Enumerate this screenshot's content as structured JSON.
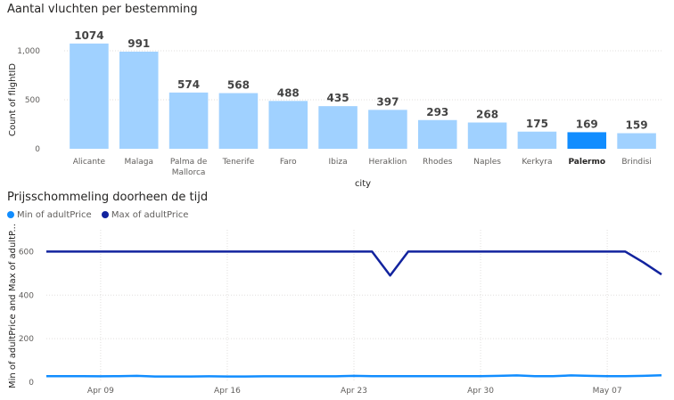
{
  "chart_data": [
    {
      "type": "bar",
      "title": "Aantal vluchten per bestemming",
      "xlabel": "city",
      "ylabel": "Count of flightID",
      "categories": [
        "Alicante",
        "Malaga",
        "Palma de Mallorca",
        "Tenerife",
        "Faro",
        "Ibiza",
        "Heraklion",
        "Rhodes",
        "Naples",
        "Kerkyra",
        "Palermo",
        "Brindisi"
      ],
      "values": [
        1074,
        991,
        574,
        568,
        488,
        435,
        397,
        293,
        268,
        175,
        169,
        159
      ],
      "ylim": [
        0,
        1100
      ],
      "yticks": [
        0,
        500,
        1000
      ],
      "ytick_labels": [
        "0",
        "500",
        "1,000"
      ],
      "highlighted_category": "Palermo",
      "colors": {
        "bar": "#a0d1ff",
        "highlight": "#118dff"
      },
      "grid": true,
      "data_labels": true
    },
    {
      "type": "line",
      "title": "Prijsschommeling doorheen de tijd",
      "xlabel": "",
      "ylabel": "Min of adultPrice and Max of adultP...",
      "legend_position": "top-left",
      "x": [
        "2021-04-06",
        "2021-04-07",
        "2021-04-08",
        "2021-04-09",
        "2021-04-10",
        "2021-04-11",
        "2021-04-12",
        "2021-04-13",
        "2021-04-14",
        "2021-04-15",
        "2021-04-16",
        "2021-04-17",
        "2021-04-18",
        "2021-04-19",
        "2021-04-20",
        "2021-04-21",
        "2021-04-22",
        "2021-04-23",
        "2021-04-24",
        "2021-04-25",
        "2021-04-26",
        "2021-04-27",
        "2021-04-28",
        "2021-04-29",
        "2021-04-30",
        "2021-05-01",
        "2021-05-02",
        "2021-05-03",
        "2021-05-04",
        "2021-05-05",
        "2021-05-06",
        "2021-05-07",
        "2021-05-08",
        "2021-05-09",
        "2021-05-10"
      ],
      "xticks": [
        "2021-04-09",
        "2021-04-16",
        "2021-04-23",
        "2021-04-30",
        "2021-05-07"
      ],
      "xtick_labels": [
        "Apr 09",
        "Apr 16",
        "Apr 23",
        "Apr 30",
        "May 07"
      ],
      "series": [
        {
          "name": "Min of adultPrice",
          "color": "#118dff",
          "values": [
            28,
            28,
            28,
            27,
            28,
            29,
            26,
            26,
            26,
            27,
            26,
            26,
            27,
            27,
            27,
            27,
            27,
            29,
            28,
            28,
            28,
            28,
            28,
            28,
            28,
            29,
            31,
            28,
            28,
            31,
            29,
            28,
            28,
            29,
            32
          ]
        },
        {
          "name": "Max of adultPrice",
          "color": "#12239e",
          "values": [
            600,
            600,
            600,
            600,
            600,
            600,
            600,
            600,
            600,
            600,
            600,
            600,
            600,
            600,
            600,
            600,
            600,
            600,
            600,
            490,
            600,
            600,
            600,
            600,
            600,
            600,
            600,
            600,
            600,
            600,
            600,
            600,
            600,
            550,
            495
          ]
        }
      ],
      "ylim": [
        0,
        700
      ],
      "yticks": [
        0,
        200,
        400,
        600
      ],
      "ytick_labels": [
        "0",
        "200",
        "400",
        "600"
      ],
      "grid": true
    }
  ]
}
